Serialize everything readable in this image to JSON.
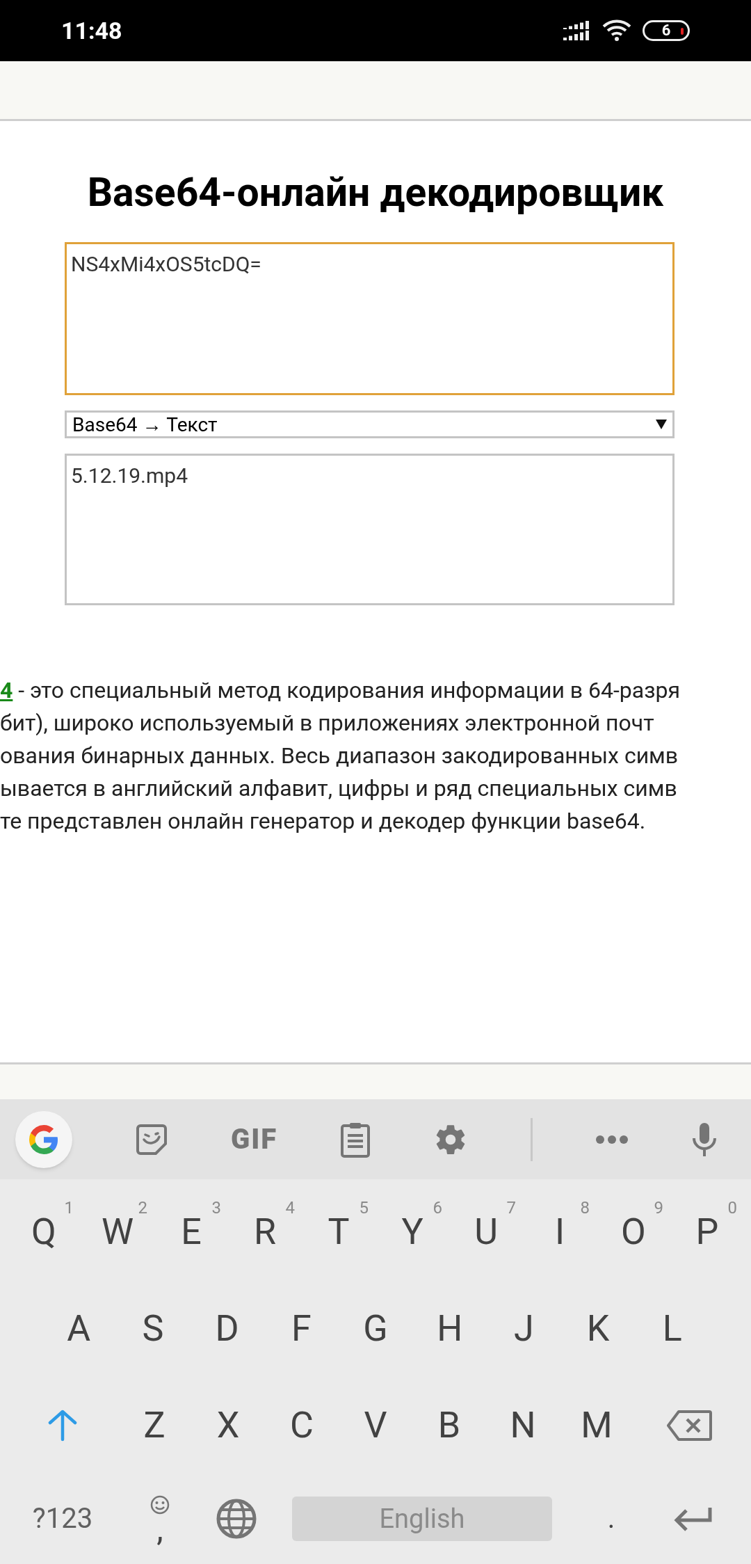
{
  "status_bar": {
    "time": "11:48",
    "battery": "6"
  },
  "page": {
    "title": "Base64-онлайн декодировщик",
    "input": {
      "value": "NS4xMi4xOS5tcDQ=",
      "focused": true
    },
    "mode_select": {
      "value": "Base64 → Текст"
    },
    "output": {
      "value": "5.12.19.mp4",
      "focused": false
    },
    "description_lines": [
      {
        "link": "4",
        "text": " - это специальный метод кодирования информации в 64-разря"
      },
      {
        "text": "бит), широко используемый в приложениях электронной почт"
      },
      {
        "text": "ования бинарных данных. Весь диапазон закодированных симв"
      },
      {
        "text": "ывается в английский алфавит, цифры и ряд специальных симв"
      },
      {
        "text": "те представлен онлайн генератор и декодер функции base64."
      }
    ]
  },
  "keyboard": {
    "toolbar": [
      {
        "kind": "google"
      },
      {
        "kind": "sticker"
      },
      {
        "kind": "gif",
        "label": "GIF"
      },
      {
        "kind": "clipboard"
      },
      {
        "kind": "settings"
      },
      {
        "kind": "divider"
      },
      {
        "kind": "more"
      },
      {
        "kind": "mic"
      }
    ],
    "rows": [
      [
        {
          "label": "Q",
          "hint": "1"
        },
        {
          "label": "W",
          "hint": "2"
        },
        {
          "label": "E",
          "hint": "3"
        },
        {
          "label": "R",
          "hint": "4"
        },
        {
          "label": "T",
          "hint": "5"
        },
        {
          "label": "Y",
          "hint": "6"
        },
        {
          "label": "U",
          "hint": "7"
        },
        {
          "label": "I",
          "hint": "8"
        },
        {
          "label": "O",
          "hint": "9"
        },
        {
          "label": "P",
          "hint": "0"
        }
      ],
      [
        {
          "label": "A"
        },
        {
          "label": "S"
        },
        {
          "label": "D"
        },
        {
          "label": "F"
        },
        {
          "label": "G"
        },
        {
          "label": "H"
        },
        {
          "label": "J"
        },
        {
          "label": "K"
        },
        {
          "label": "L"
        }
      ],
      [
        {
          "kind": "shift"
        },
        {
          "label": "Z"
        },
        {
          "label": "X"
        },
        {
          "label": "C"
        },
        {
          "label": "V"
        },
        {
          "label": "B"
        },
        {
          "label": "N"
        },
        {
          "label": "M"
        },
        {
          "kind": "backspace"
        }
      ]
    ],
    "bottom_row": [
      {
        "kind": "symbols",
        "label": "?123"
      },
      {
        "kind": "comma",
        "label": ","
      },
      {
        "kind": "globe"
      },
      {
        "kind": "space",
        "label": "English"
      },
      {
        "kind": "period",
        "label": "."
      },
      {
        "kind": "enter"
      }
    ]
  }
}
